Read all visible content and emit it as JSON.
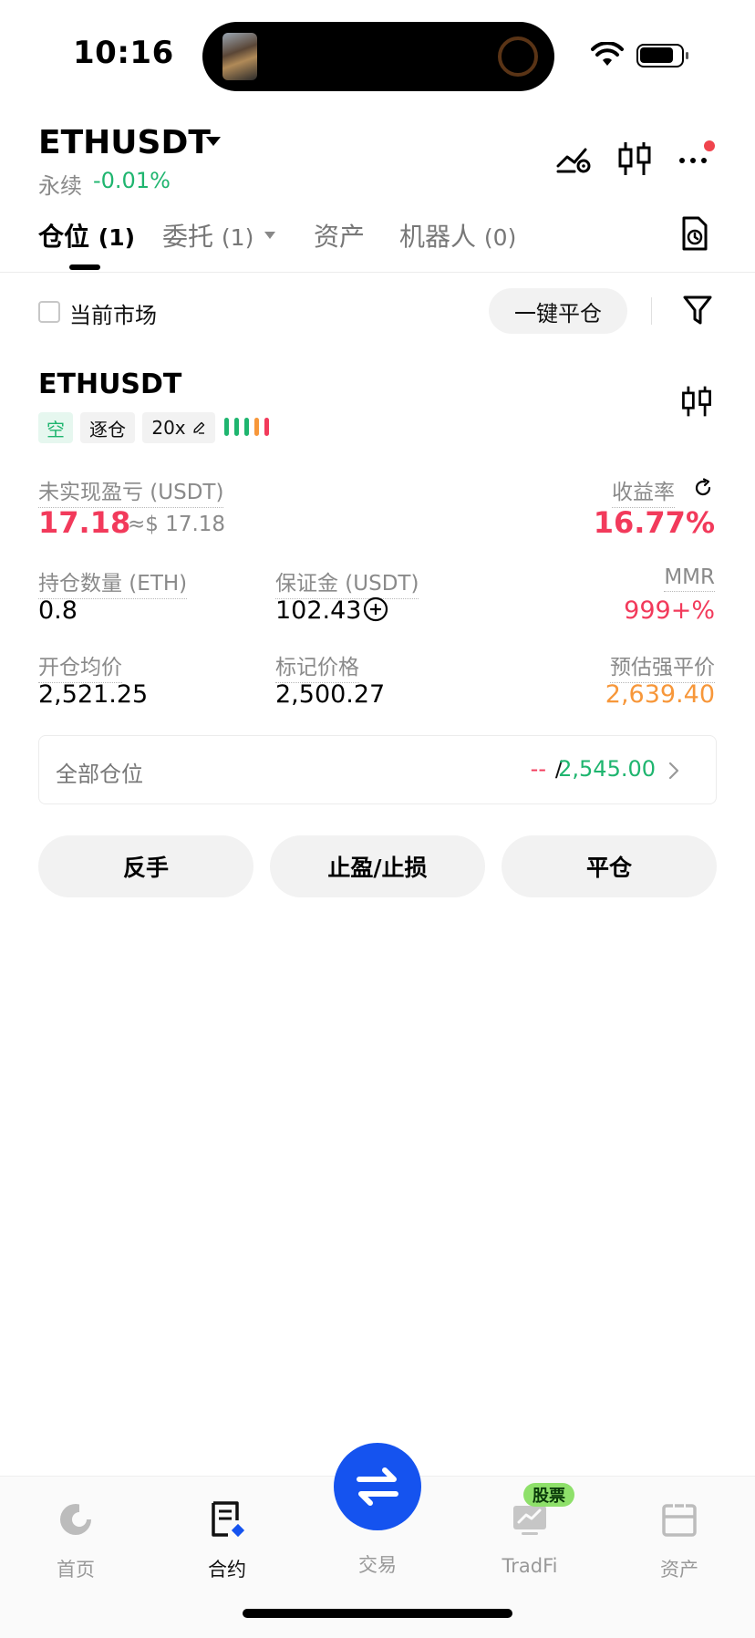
{
  "status_bar": {
    "time": "10:16"
  },
  "header": {
    "symbol": "ETHUSDT",
    "contract_type": "永续",
    "change": "-0.01%",
    "icons": [
      "price-alert-icon",
      "kline-icon",
      "more-icon"
    ]
  },
  "tabs": [
    {
      "label": "仓位",
      "count": "(1)",
      "active": true
    },
    {
      "label": "委托",
      "count": "(1)",
      "active": false
    },
    {
      "label": "资产",
      "count": "",
      "active": false
    },
    {
      "label": "机器人",
      "count": "(0)",
      "active": false
    }
  ],
  "filter_row": {
    "checkbox_label": "当前市场",
    "close_all_button": "一键平仓"
  },
  "position": {
    "symbol": "ETHUSDT",
    "side_tag": "空",
    "margin_mode_tag": "逐仓",
    "leverage_tag": "20x",
    "unrealized_pnl_label": "未实现盈亏 (USDT)",
    "unrealized_pnl_value": "17.18",
    "unrealized_pnl_usd": "≈$ 17.18",
    "roe_label": "收益率",
    "roe_value": "16.77%",
    "quantity_label": "持仓数量 (ETH)",
    "quantity_value": "0.8",
    "margin_label": "保证金 (USDT)",
    "margin_value": "102.43",
    "mmr_label": "MMR",
    "mmr_value": "999+%",
    "entry_price_label": "开仓均价",
    "entry_price_value": "2,521.25",
    "mark_price_label": "标记价格",
    "mark_price_value": "2,500.27",
    "liq_price_label": "预估强平价",
    "liq_price_value": "2,639.40"
  },
  "all_positions": {
    "label": "全部仓位",
    "pnl": "--",
    "separator": "/",
    "value": "2,545.00"
  },
  "actions": {
    "reverse": "反手",
    "tp_sl": "止盈/止损",
    "close": "平仓"
  },
  "bottom_nav": {
    "home": "首页",
    "futures": "合约",
    "trade": "交易",
    "tradfi": "TradFi",
    "tradfi_badge": "股票",
    "assets": "资产"
  },
  "colors": {
    "up_green": "#1fb56f",
    "down_red": "#f23a5b",
    "liq_orange": "#f7973a",
    "brand_blue": "#1553ef"
  }
}
